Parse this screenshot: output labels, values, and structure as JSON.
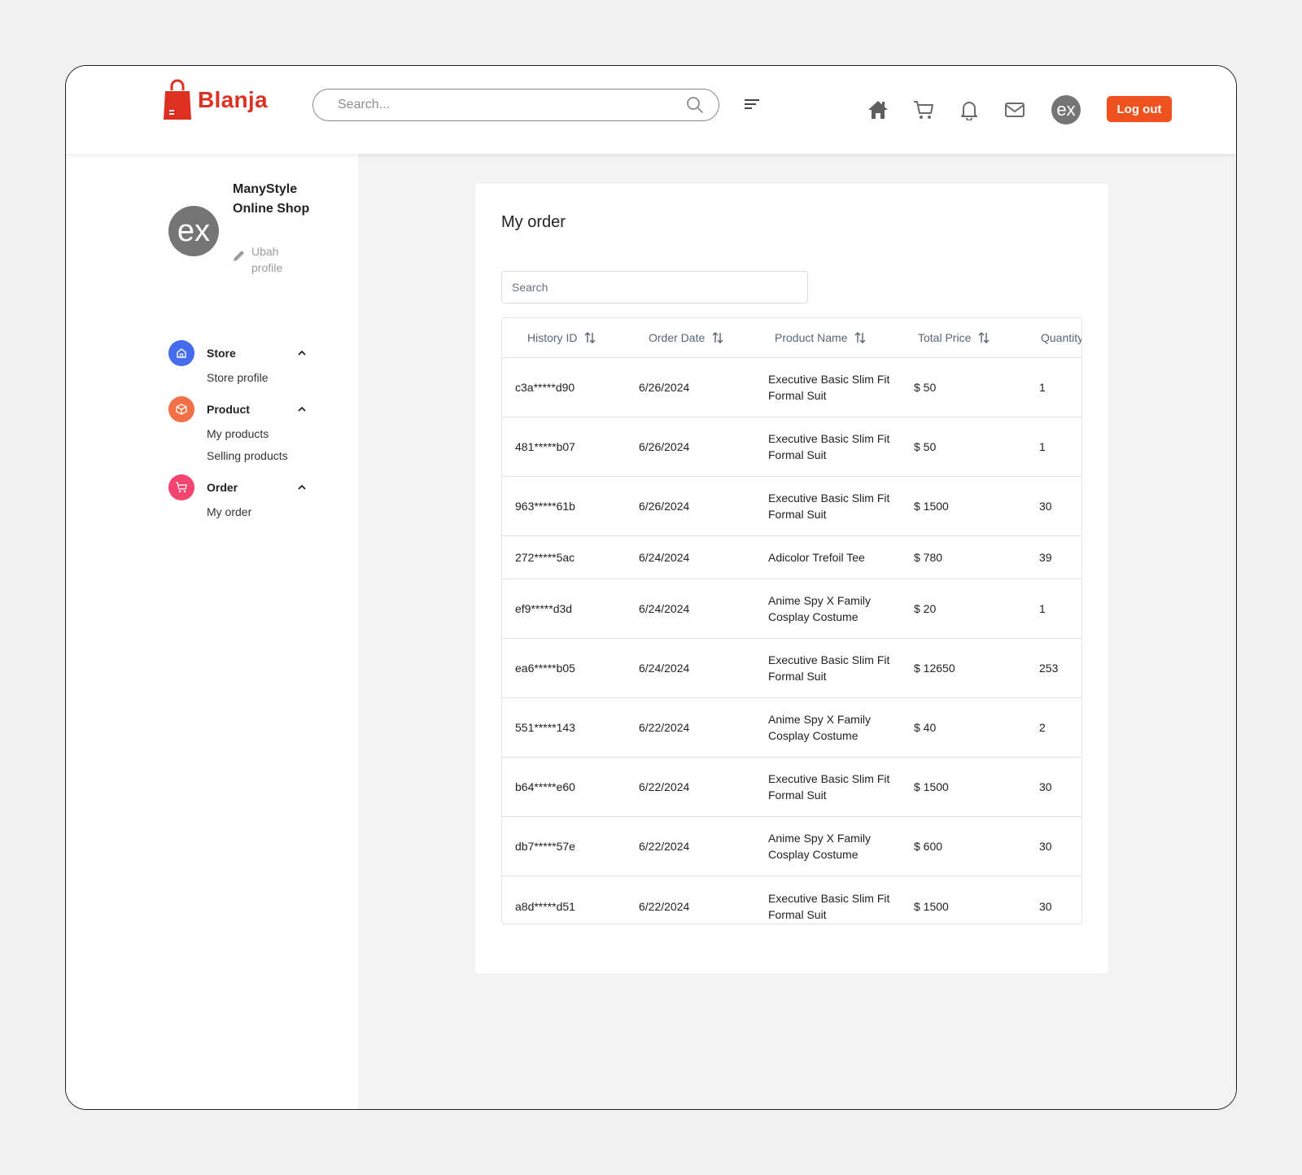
{
  "header": {
    "brand": "Blanja",
    "search_placeholder": "Search...",
    "logout_label": "Log out",
    "avatar_text": "ex"
  },
  "sidebar": {
    "avatar_text": "ex",
    "shop_name": "ManyStyle Online Shop",
    "edit_profile_label": "Ubah profile",
    "groups": [
      {
        "title": "Store",
        "icon": "home-icon",
        "color": "#456bef",
        "items": [
          "Store profile"
        ]
      },
      {
        "title": "Product",
        "icon": "package-icon",
        "color": "#f36f45",
        "items": [
          "My products",
          "Selling products"
        ]
      },
      {
        "title": "Order",
        "icon": "cart-icon",
        "color": "#f3456f",
        "items": [
          "My order"
        ]
      }
    ]
  },
  "main": {
    "title": "My order",
    "search_placeholder": "Search",
    "columns": [
      "History ID",
      "Order Date",
      "Product Name",
      "Total Price",
      "Quantity"
    ],
    "rows": [
      {
        "id": "c3a*****d90",
        "date": "6/26/2024",
        "product": "Executive Basic Slim Fit Formal Suit",
        "price": "$ 50",
        "qty": "1"
      },
      {
        "id": "481*****b07",
        "date": "6/26/2024",
        "product": "Executive Basic Slim Fit Formal Suit",
        "price": "$ 50",
        "qty": "1"
      },
      {
        "id": "963*****61b",
        "date": "6/26/2024",
        "product": "Executive Basic Slim Fit Formal Suit",
        "price": "$ 1500",
        "qty": "30"
      },
      {
        "id": "272*****5ac",
        "date": "6/24/2024",
        "product": "Adicolor Trefoil Tee",
        "price": "$ 780",
        "qty": "39"
      },
      {
        "id": "ef9*****d3d",
        "date": "6/24/2024",
        "product": "Anime Spy X Family Cosplay Costume",
        "price": "$ 20",
        "qty": "1"
      },
      {
        "id": "ea6*****b05",
        "date": "6/24/2024",
        "product": "Executive Basic Slim Fit Formal Suit",
        "price": "$ 12650",
        "qty": "253"
      },
      {
        "id": "551*****143",
        "date": "6/22/2024",
        "product": "Anime Spy X Family Cosplay Costume",
        "price": "$ 40",
        "qty": "2"
      },
      {
        "id": "b64*****e60",
        "date": "6/22/2024",
        "product": "Executive Basic Slim Fit Formal Suit",
        "price": "$ 1500",
        "qty": "30"
      },
      {
        "id": "db7*****57e",
        "date": "6/22/2024",
        "product": "Anime Spy X Family Cosplay Costume",
        "price": "$ 600",
        "qty": "30"
      },
      {
        "id": "a8d*****d51",
        "date": "6/22/2024",
        "product": "Executive Basic Slim Fit Formal Suit",
        "price": "$ 1500",
        "qty": "30"
      }
    ]
  },
  "colors": {
    "brand": "#db3022",
    "logout": "#f0521f"
  }
}
